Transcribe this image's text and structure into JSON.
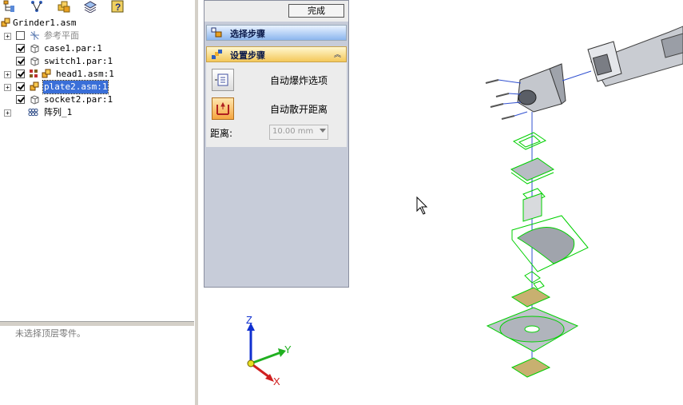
{
  "tree": {
    "root": "Grinder1.asm",
    "nodes": [
      {
        "label": "参考平面",
        "checked": false,
        "icon": "reference-plane-icon"
      },
      {
        "label": "case1.par:1",
        "checked": true,
        "icon": "part-icon"
      },
      {
        "label": "switch1.par:1",
        "checked": true,
        "icon": "part-icon"
      },
      {
        "label": "head1.asm:1",
        "checked": true,
        "icon": "assembly-icon"
      },
      {
        "label": "plate2.asm:1",
        "checked": true,
        "icon": "assembly-icon",
        "selected": true
      },
      {
        "label": "socket2.par:1",
        "checked": true,
        "icon": "part-icon"
      },
      {
        "label": "阵列_1",
        "icon": "pattern-icon"
      }
    ]
  },
  "status_text": "未选择顶层零件。",
  "command_panel": {
    "done_label": "完成",
    "select_step_title": "选择步骤",
    "setup_step_title": "设置步骤",
    "auto_explode_options_label": "自动爆炸选项",
    "auto_spread_distance_label": "自动散开距离",
    "distance_label": "距离:",
    "distance_value": "10.00 mm"
  },
  "triad": {
    "x_label": "X",
    "y_label": "Y",
    "z_label": "Z"
  },
  "colors": {
    "selection": "#3a6fd8",
    "wireframe": "#00d000",
    "select_band": "#8cb6ee",
    "setup_band": "#f4c85a"
  }
}
